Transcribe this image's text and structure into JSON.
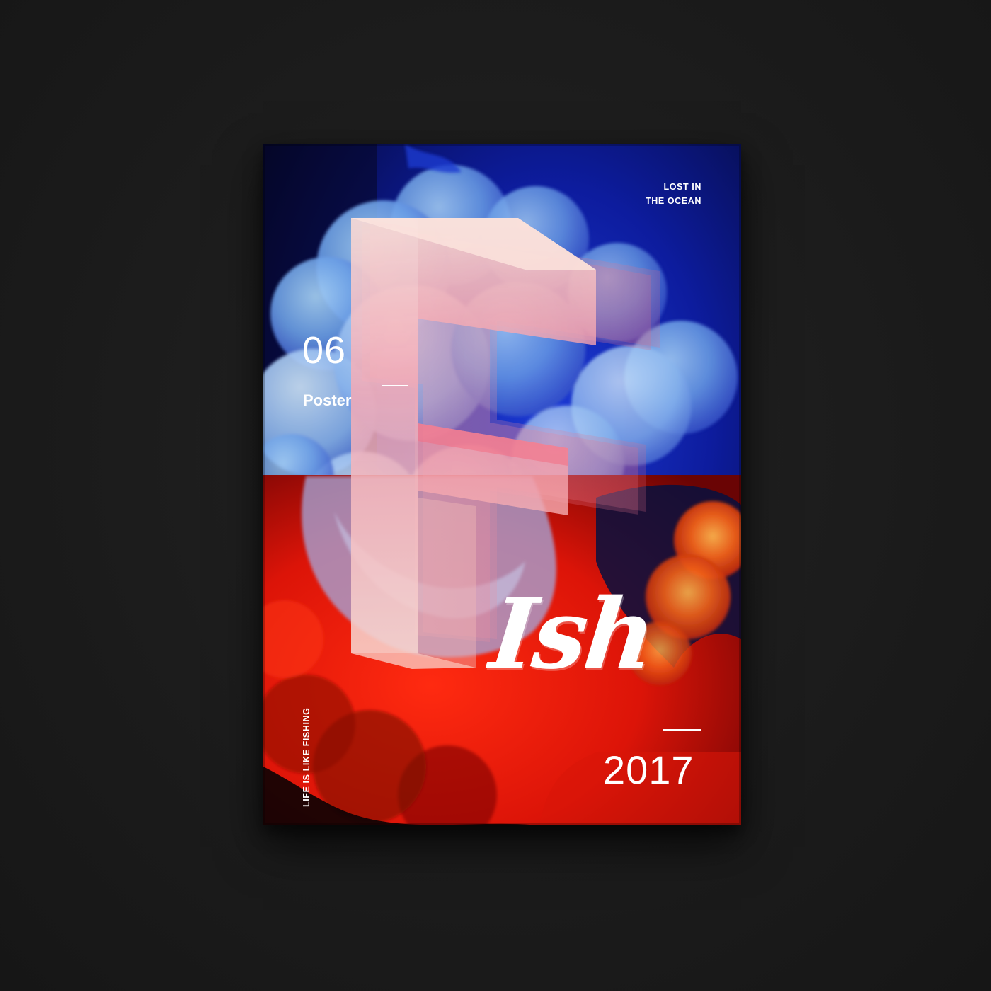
{
  "poster": {
    "tagline_line1": "LOST IN",
    "tagline_line2": "THE OCEAN",
    "number": "06",
    "label": "Poster",
    "big_letter": "F",
    "title_rest": "Ish",
    "year": "2017",
    "side_text": "LIFE IS LIKE FISHING"
  },
  "colors": {
    "background": "#1c1c1c",
    "deep_blue": "#0a1a8c",
    "smoke_blue": "#6fa6e6",
    "red": "#e0180e",
    "orange": "#f26a1b",
    "letter_pink": "#f4c2bd"
  }
}
